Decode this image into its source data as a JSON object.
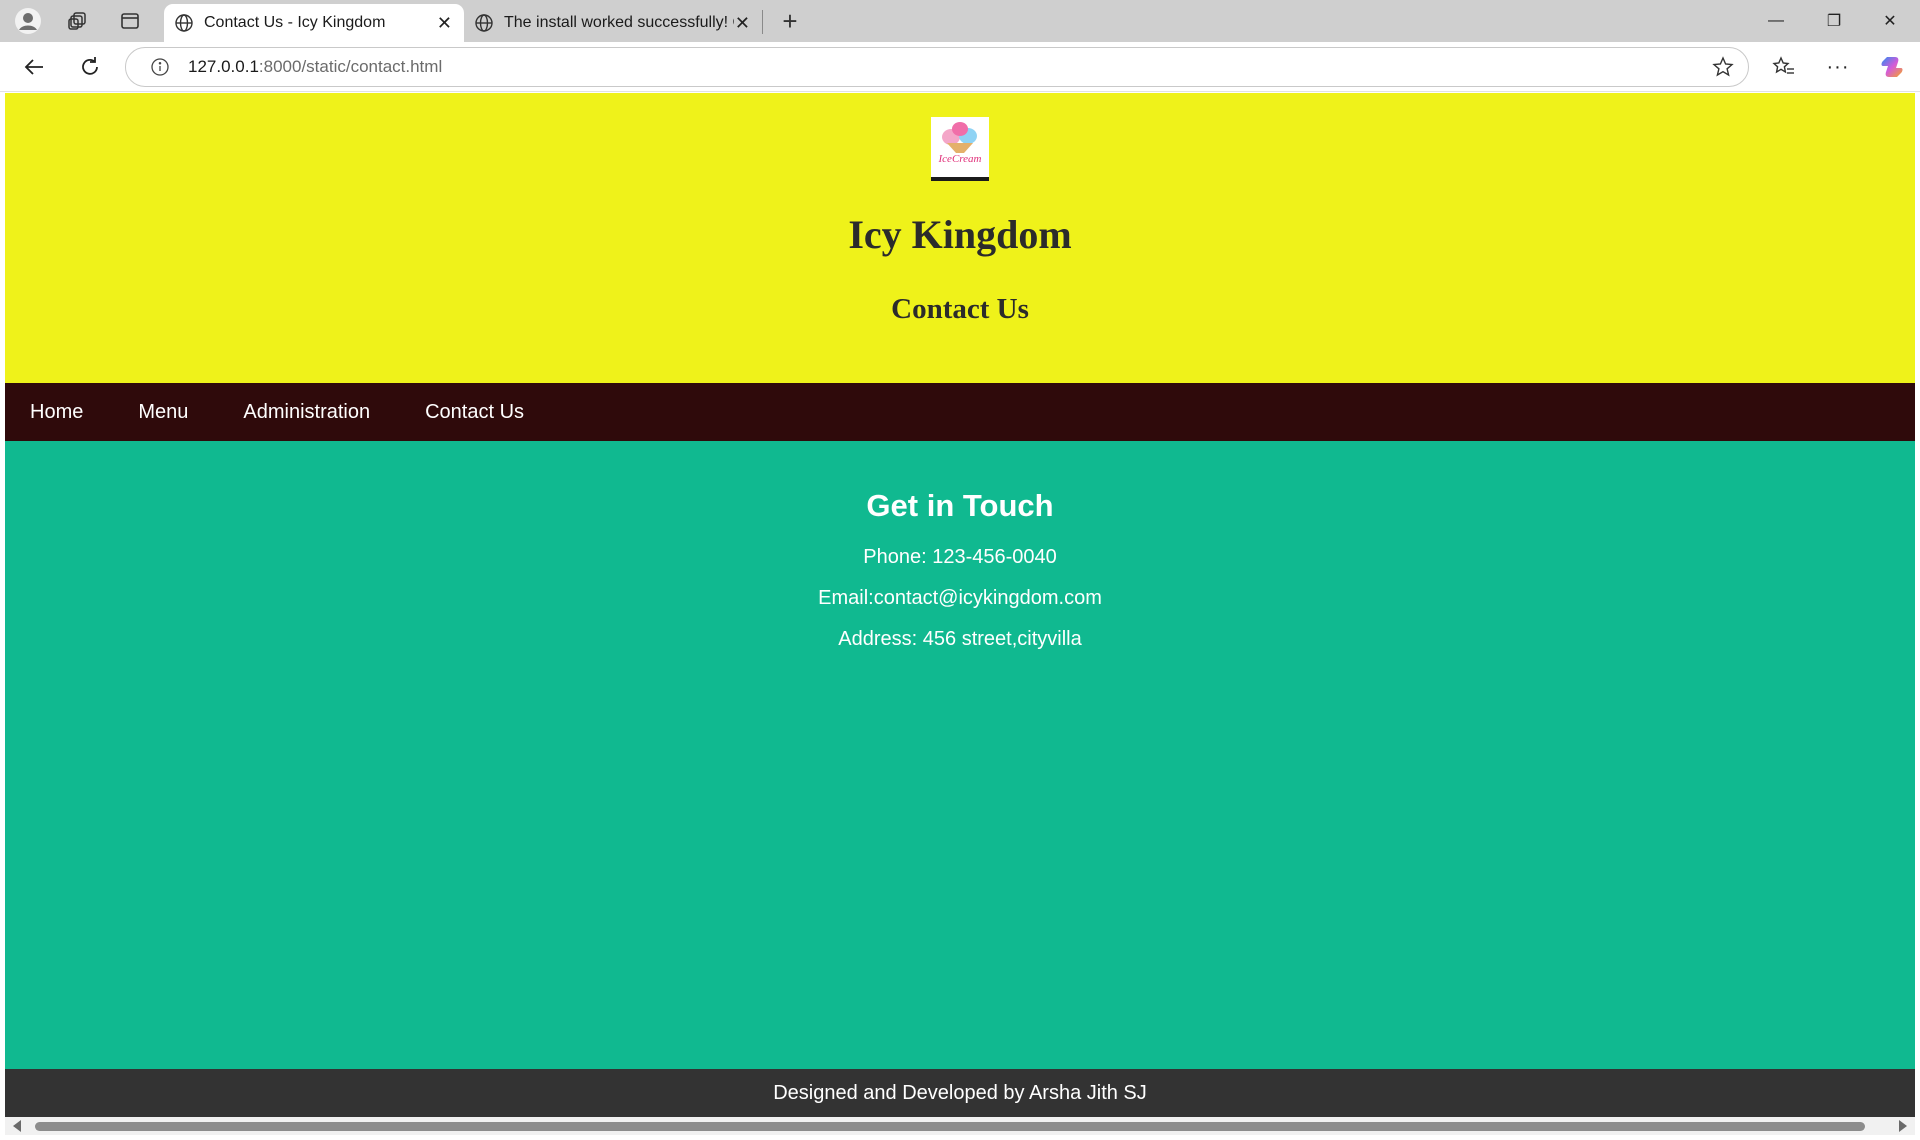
{
  "browser": {
    "tabs": [
      {
        "title": "Contact Us - Icy Kingdom",
        "active": true
      },
      {
        "title": "The install worked successfully! Co",
        "active": false
      }
    ],
    "url_host": "127.0.0.1",
    "url_rest": ":8000/static/contact.html"
  },
  "header": {
    "logo_text": "IceCream",
    "site_title": "Icy Kingdom",
    "page_heading": "Contact Us"
  },
  "nav": {
    "items": [
      "Home",
      "Menu",
      "Administration",
      "Contact Us"
    ]
  },
  "contact": {
    "heading": "Get in Touch",
    "phone": "Phone: 123-456-0040",
    "email": "Email:contact@icykingdom.com",
    "address": "Address: 456 street,cityvilla"
  },
  "footer": {
    "credit": "Designed and Developed by Arsha Jith SJ"
  },
  "colors": {
    "header_bg": "#eff21a",
    "nav_bg": "#2f0a0b",
    "content_bg": "#10b990",
    "footer_bg": "#333333"
  }
}
